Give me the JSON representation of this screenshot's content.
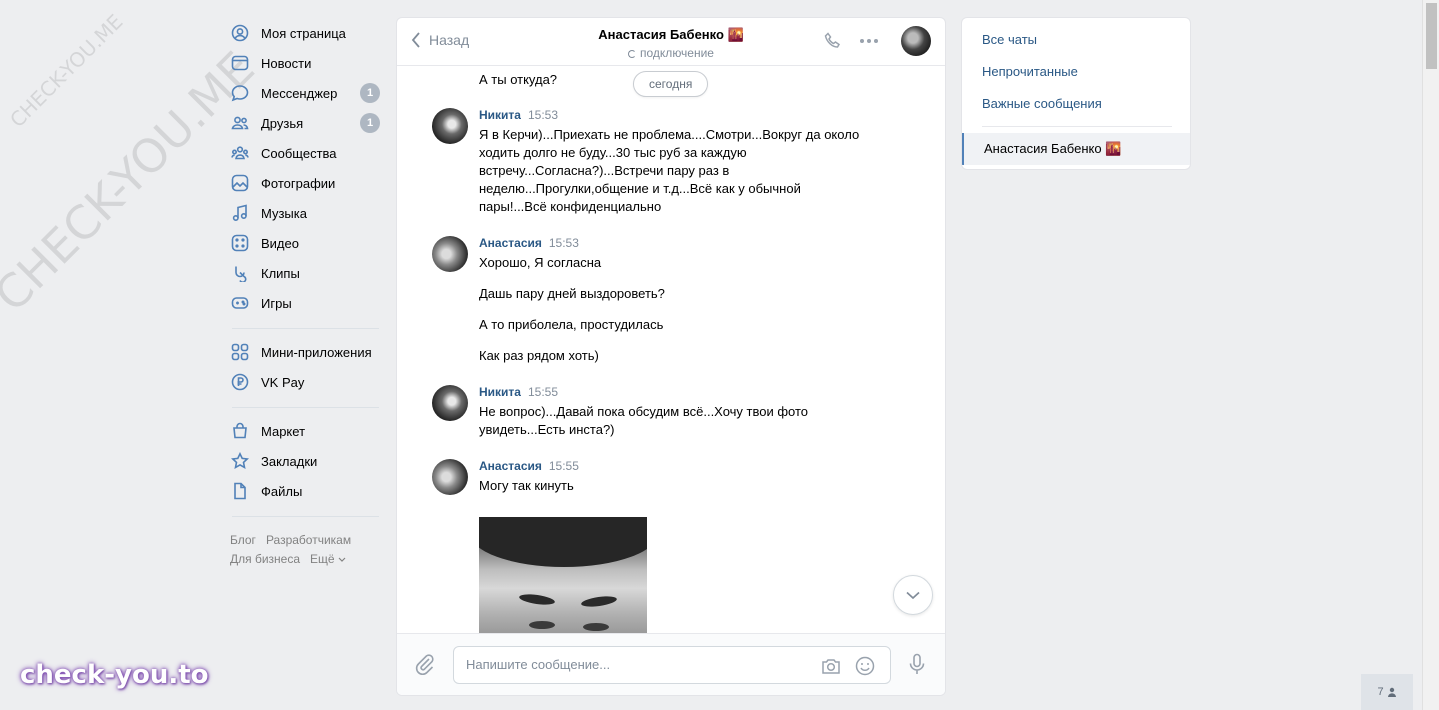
{
  "watermark": {
    "small": "CHECK-YOU.ME",
    "large": "CHECK-YOU.ME",
    "brand": "check-you.to"
  },
  "nav": {
    "items": [
      {
        "label": "Моя страница",
        "icon": "user-circle-icon"
      },
      {
        "label": "Новости",
        "icon": "news-icon"
      },
      {
        "label": "Мессенджер",
        "icon": "message-icon",
        "badge": "1"
      },
      {
        "label": "Друзья",
        "icon": "friends-icon",
        "badge": "1"
      },
      {
        "label": "Сообщества",
        "icon": "communities-icon"
      },
      {
        "label": "Фотографии",
        "icon": "photos-icon"
      },
      {
        "label": "Музыка",
        "icon": "music-icon"
      },
      {
        "label": "Видео",
        "icon": "video-icon"
      },
      {
        "label": "Клипы",
        "icon": "clips-icon"
      },
      {
        "label": "Игры",
        "icon": "games-icon"
      }
    ],
    "items2": [
      {
        "label": "Мини-приложения",
        "icon": "apps-icon"
      },
      {
        "label": "VK Pay",
        "icon": "vkpay-icon"
      }
    ],
    "items3": [
      {
        "label": "Маркет",
        "icon": "market-icon"
      },
      {
        "label": "Закладки",
        "icon": "bookmark-icon"
      },
      {
        "label": "Файлы",
        "icon": "files-icon"
      }
    ],
    "footer": {
      "blog": "Блог",
      "dev": "Разработчикам",
      "business": "Для бизнеса",
      "more": "Ещё"
    }
  },
  "chat": {
    "back_label": "Назад",
    "peer_name": "Анастасия Бабенко 🌇",
    "peer_status": "подключение",
    "first_line": "А ты откуда?",
    "date_pill": "сегодня",
    "messages": [
      {
        "author": "Никита",
        "time": "15:53",
        "texts": [
          "Я в Керчи)...Приехать не проблема....Смотри...Вокруг да около ходить долго не буду...30 тыс руб за каждую встречу...Согласна?)...Встречи пару раз в неделю...Прогулки,общение и т.д...Всё как у обычной пары!...Всё конфиденциально"
        ]
      },
      {
        "author": "Анастасия",
        "time": "15:53",
        "texts": [
          "Хорошо, Я согласна",
          "Дашь пару дней выздороветь?",
          "А то приболела, простудилась",
          "Как раз рядом хоть)"
        ]
      },
      {
        "author": "Никита",
        "time": "15:55",
        "texts": [
          "Не вопрос)...Давай пока обсудим всё...Хочу твои фото увидеть...Есть инста?)"
        ]
      },
      {
        "author": "Анастасия",
        "time": "15:55",
        "texts": [
          "Могу так кинуть"
        ]
      }
    ],
    "composer_placeholder": "Напишите сообщение..."
  },
  "right": {
    "all": "Все чаты",
    "unread": "Непрочитанные",
    "important": "Важные сообщения",
    "active_chat": "Анастасия Бабенко 🌇"
  },
  "online_count": "7"
}
